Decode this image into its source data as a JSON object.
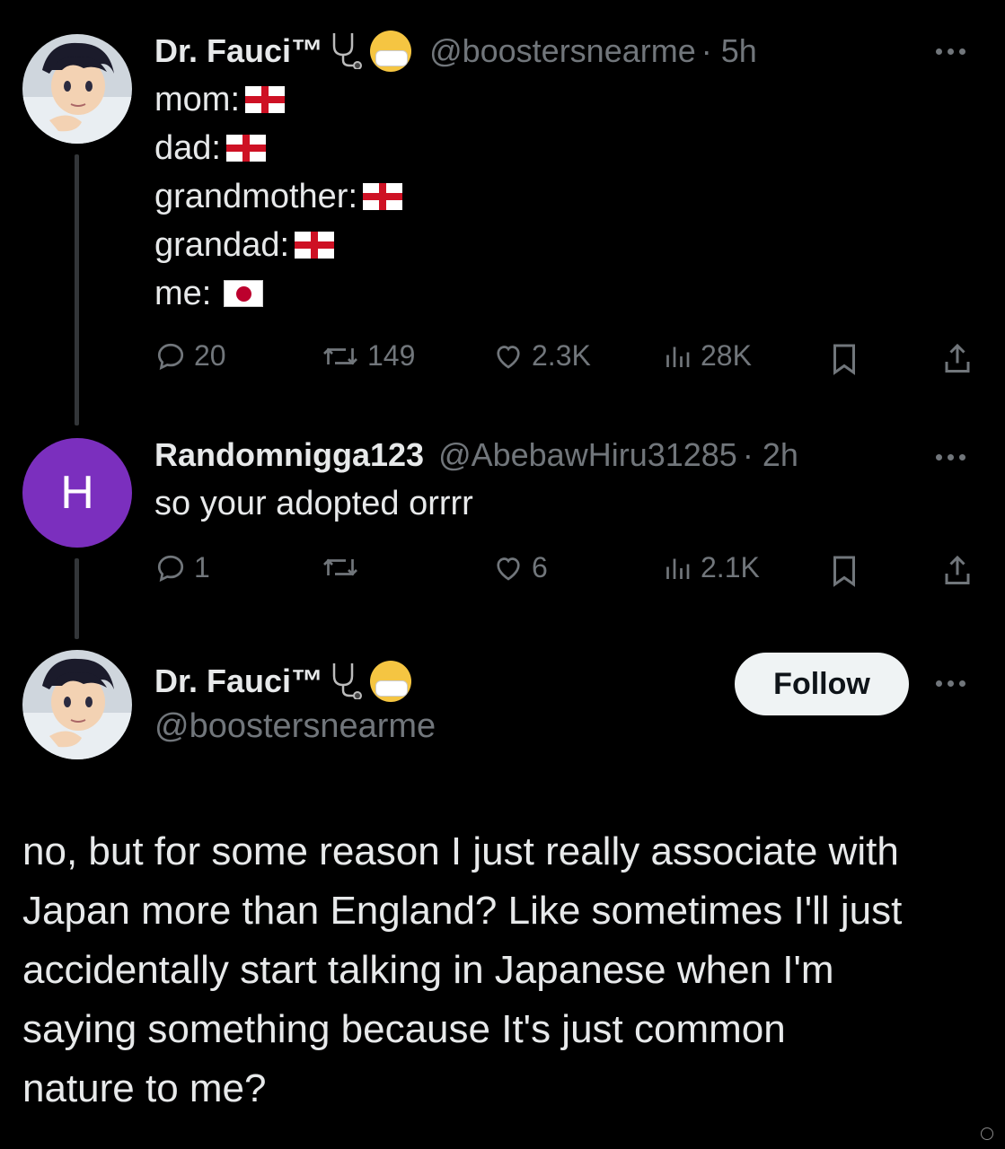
{
  "tweet1": {
    "name": "Dr. Fauci™",
    "handle": "@boostersnearme",
    "time": "· 5h",
    "lines": [
      {
        "label": "mom:",
        "flag": "england"
      },
      {
        "label": "dad:",
        "flag": "england"
      },
      {
        "label": "grandmother:",
        "flag": "england"
      },
      {
        "label": "grandad:",
        "flag": "england"
      },
      {
        "label": "me:",
        "flag": "japan"
      }
    ],
    "replies": "20",
    "reposts": "149",
    "likes": "2.3K",
    "views": "28K"
  },
  "tweet2": {
    "avatar_letter": "H",
    "name": "Randomnigga123",
    "handle": "@AbebawHiru31285",
    "time": "· 2h",
    "text": "so your adopted orrrr",
    "replies": "1",
    "likes": "6",
    "views": "2.1K"
  },
  "tweet3": {
    "name": "Dr. Fauci™",
    "handle": "@boostersnearme",
    "follow_label": "Follow",
    "text_lines": [
      "no, but for some reason I just really associate with",
      "Japan more than England? Like sometimes I'll just",
      "accidentally start talking in Japanese when I'm",
      "saying something because It's just common",
      "nature to me?"
    ]
  },
  "icons": [
    "stethoscope-icon",
    "mask-face-emoji",
    "reply-icon",
    "repost-icon",
    "like-icon",
    "views-icon",
    "bookmark-icon",
    "share-icon",
    "more-icon"
  ],
  "colors": {
    "background": "#000000",
    "text": "#e7e9ea",
    "muted": "#71767b",
    "avatar_purple": "#7b2fbe",
    "follow_bg": "#eff3f4"
  }
}
